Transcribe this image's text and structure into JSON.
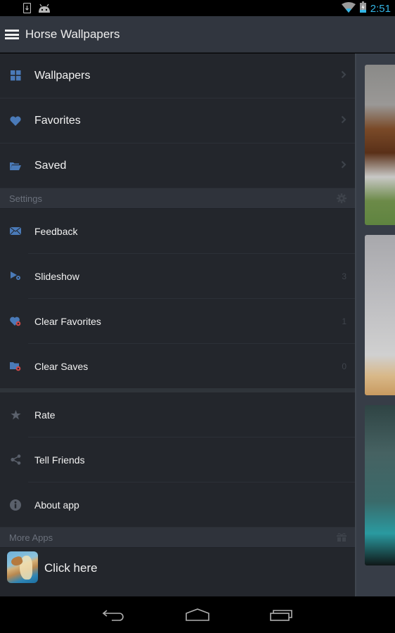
{
  "status_bar": {
    "time": "2:51",
    "left_icons": [
      "download-notification-icon",
      "android-debug-icon"
    ],
    "right_icons": [
      "wifi-icon",
      "battery-charging-icon"
    ],
    "accent_color": "#33b5e5"
  },
  "action_bar": {
    "menu_icon": "hamburger-menu-icon",
    "title": "Horse Wallpapers"
  },
  "drawer": {
    "main_items": [
      {
        "label": "Wallpapers",
        "icon": "grid-icon",
        "trail_icon": "chevron-right-icon"
      },
      {
        "label": "Favorites",
        "icon": "heart-icon",
        "trail_icon": "chevron-right-icon"
      },
      {
        "label": "Saved",
        "icon": "folder-open-icon",
        "trail_icon": "chevron-right-icon"
      }
    ],
    "settings_section": {
      "header": "Settings",
      "header_icon": "gear-icon",
      "items": [
        {
          "label": "Feedback",
          "icon": "envelope-icon",
          "value": ""
        },
        {
          "label": "Slideshow",
          "icon": "slideshow-settings-icon",
          "value": "3"
        },
        {
          "label": "Clear Favorites",
          "icon": "heart-clear-icon",
          "value": "1"
        },
        {
          "label": "Clear Saves",
          "icon": "folder-clear-icon",
          "value": "0"
        }
      ]
    },
    "misc_items": [
      {
        "label": "Rate",
        "icon": "star-icon"
      },
      {
        "label": "Tell Friends",
        "icon": "share-icon"
      },
      {
        "label": "About app",
        "icon": "info-icon"
      }
    ],
    "more_apps_section": {
      "header": "More Apps",
      "header_icon": "gift-icon",
      "item": {
        "label": "Click here",
        "icon": "horse-app-icon"
      }
    }
  },
  "content": {
    "thumbnails": [
      {
        "name": "running-horses-wallpaper"
      },
      {
        "name": "horse-desert-wallpaper"
      },
      {
        "name": "horse-teal-sky-wallpaper"
      }
    ]
  },
  "nav_bar": {
    "buttons": [
      "back-icon",
      "home-icon",
      "recent-apps-icon"
    ]
  },
  "colors": {
    "drawer_bg": "#23262c",
    "action_bar_bg": "#31363f",
    "icon_blue": "#4a7ab8",
    "icon_gray": "#5a606b",
    "icon_red_badge": "#d04848"
  }
}
